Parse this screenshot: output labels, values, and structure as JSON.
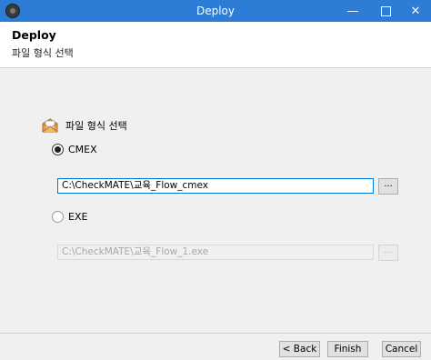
{
  "window": {
    "title": "Deploy",
    "app_icon": "app-logo-icon",
    "controls": {
      "minimize": "—",
      "maximize": "maximize-icon",
      "close": "✕"
    }
  },
  "header": {
    "title": "Deploy",
    "subtitle": "파일 형식 선택"
  },
  "section": {
    "icon": "folder-envelope-icon",
    "label": "파일 형식 선택"
  },
  "options": [
    {
      "label": "CMEX",
      "selected": true,
      "path": "C:\\CheckMATE\\교육_Flow_cmex",
      "browse_label": "..."
    },
    {
      "label": "EXE",
      "selected": false,
      "path": "C:\\CheckMATE\\교육_Flow_1.exe",
      "browse_label": "..."
    }
  ],
  "buttons": {
    "back": "< Back",
    "finish": "Finish",
    "cancel": "Cancel"
  },
  "colors": {
    "titlebar": "#2d7cd6",
    "focus_border": "#0078d7"
  }
}
